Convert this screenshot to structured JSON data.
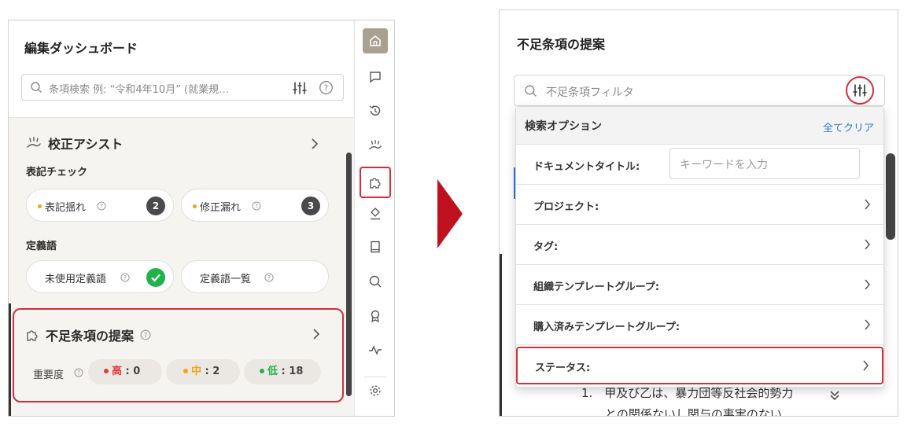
{
  "left_panel": {
    "title": "編集ダッシュボード",
    "search_placeholder": "条項検索 例: “令和4年10月” (就業規…",
    "assist": {
      "title": "校正アシスト",
      "notation_check_label": "表記チェック",
      "notation_inconsistency": {
        "label": "表記揺れ",
        "count": "2"
      },
      "missed_fix": {
        "label": "修正漏れ",
        "count": "3"
      },
      "definitions_label": "定義語",
      "unused_definitions": {
        "label": "未使用定義語"
      },
      "definitions_list": {
        "label": "定義語一覧"
      }
    },
    "missing_clauses": {
      "title": "不足条項の提案",
      "severity_label": "重要度",
      "high": {
        "label": "高",
        "value": ": 0",
        "color": "#e23b3b"
      },
      "medium": {
        "label": "中",
        "value": ": 2",
        "color": "#f2a31b"
      },
      "low": {
        "label": "低",
        "value": ": 18",
        "color": "#21b24d"
      }
    },
    "rail_icons": [
      "home-icon",
      "comment-icon",
      "history-icon",
      "assist-icon",
      "puzzle-icon",
      "stamp-icon",
      "book-icon",
      "search-icon",
      "award-icon",
      "activity-icon",
      "settings-icon"
    ]
  },
  "right_panel": {
    "title": "不足条項の提案",
    "filter_placeholder": "不足条項フィルタ",
    "dropdown": {
      "header": "検索オプション",
      "clear_all": "全てクリア",
      "document_title_label": "ドキュメントタイトル:",
      "document_title_placeholder": "キーワードを入力",
      "rows": [
        "プロジェクト:",
        "タグ:",
        "組織テンプレートグループ:",
        "購入済みテンプレートグループ:",
        "ステータス:"
      ]
    },
    "background_text_1": "1.　甲及び乙は、暴力団等反社会的勢力",
    "background_text_2": "との関係ないし関与の事実のない"
  },
  "colors": {
    "highlight_red": "#d92b3a",
    "arrow_red": "#c0111f",
    "link_blue": "#2a7ad5",
    "home_active": "#a8a090"
  }
}
